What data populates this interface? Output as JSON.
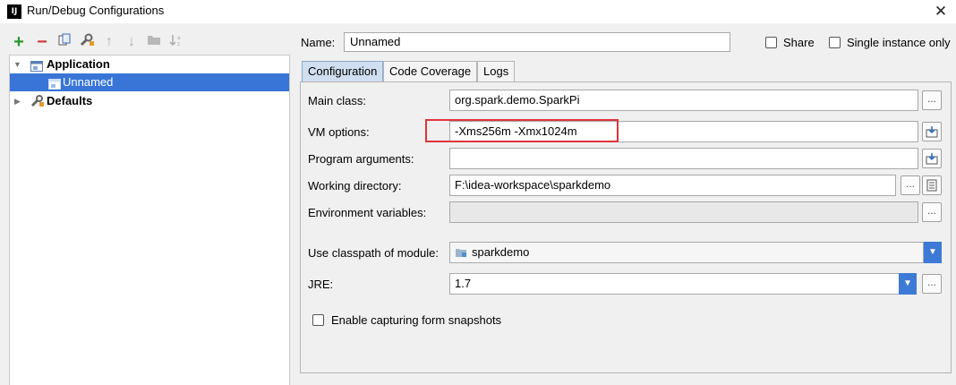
{
  "window": {
    "title": "Run/Debug Configurations",
    "close": "✕",
    "app_icon_text": "IJ"
  },
  "toolbar": {
    "add": "+",
    "remove": "−",
    "copy": "copy",
    "edit_defaults": "wrench",
    "move_up": "↑",
    "move_down": "↓",
    "folder": "folder",
    "sort": "sort"
  },
  "tree": {
    "items": [
      {
        "label": "Application",
        "icon": "application-icon",
        "expanded": true,
        "bold": true
      },
      {
        "label": "Unnamed",
        "icon": "config-icon",
        "selected": true
      },
      {
        "label": "Defaults",
        "icon": "wrench-icon",
        "expanded": false,
        "bold": true
      }
    ]
  },
  "header": {
    "name_label": "Name:",
    "name_value": "Unnamed",
    "share_label": "Share",
    "single_instance_label": "Single instance only"
  },
  "tabs": [
    "Configuration",
    "Code Coverage",
    "Logs"
  ],
  "form": {
    "main_class": {
      "label": "Main class:",
      "value": "org.spark.demo.SparkPi",
      "button": "..."
    },
    "vm_options": {
      "label": "VM options:",
      "value": "-Xms256m -Xmx1024m"
    },
    "program_arguments": {
      "label": "Program arguments:",
      "value": ""
    },
    "working_directory": {
      "label": "Working directory:",
      "value": "F:\\idea-workspace\\sparkdemo",
      "button": "..."
    },
    "environment_variables": {
      "label": "Environment variables:",
      "value": "",
      "button": "..."
    },
    "module": {
      "label": "Use classpath of module:",
      "value": "sparkdemo"
    },
    "jre": {
      "label": "JRE:",
      "value": "1.7",
      "button": "..."
    },
    "form_snapshots": {
      "label": "Enable capturing form snapshots",
      "checked": false
    }
  },
  "colors": {
    "selection": "#3875d7",
    "highlight_box": "#e0333a",
    "combo_accent": "#3d7ad6"
  }
}
